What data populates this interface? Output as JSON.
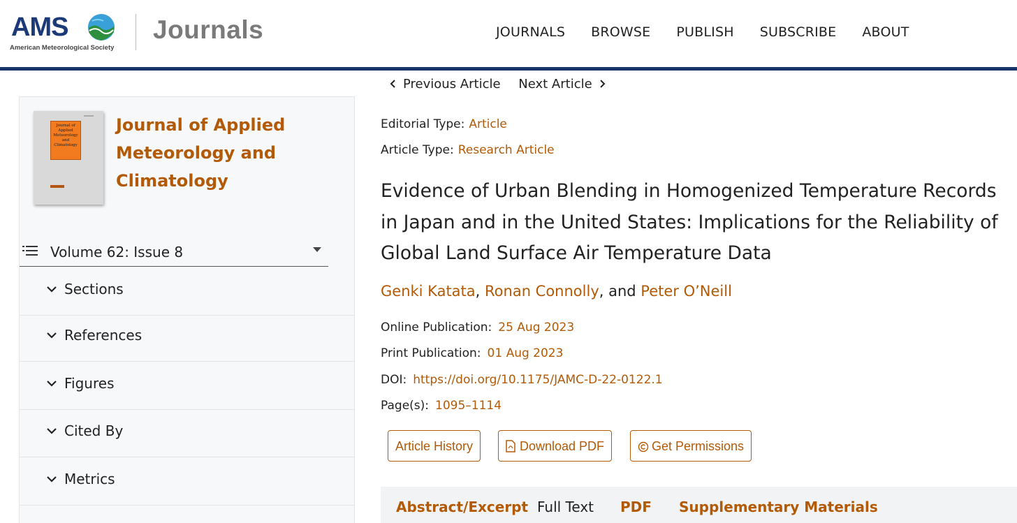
{
  "header": {
    "logo_text": "AMS",
    "logo_subtext": "American Meteorological Society",
    "site_name": "Journals",
    "nav": [
      "JOURNALS",
      "BROWSE",
      "PUBLISH",
      "SUBSCRIBE",
      "ABOUT"
    ]
  },
  "sidebar": {
    "journal_title": "Journal of Applied Meteorology and Climatology",
    "cover_text": "Journal of Applied Meteorology and Climatology",
    "volume": "Volume 62: Issue 8",
    "sections": [
      "Sections",
      "References",
      "Figures",
      "Cited By",
      "Metrics"
    ]
  },
  "pager": {
    "previous": "Previous Article",
    "next": "Next Article"
  },
  "meta": {
    "editorial_type_label": "Editorial Type:",
    "editorial_type": "Article",
    "article_type_label": "Article Type:",
    "article_type": "Research Article",
    "online_pub_label": "Online Publication:",
    "online_pub": "25 Aug 2023",
    "print_pub_label": "Print Publication:",
    "print_pub": "01 Aug 2023",
    "doi_label": "DOI:",
    "doi": "https://doi.org/10.1175/JAMC-D-22-0122.1",
    "pages_label": "Page(s):",
    "pages": "1095–1114"
  },
  "article": {
    "title": "Evidence of Urban Blending in Homogenized Temperature Records in Japan and in the United States: Implications for the Reliability of Global Land Surface Air Temperature Data",
    "authors": [
      "Genki Katata",
      "Ronan Connolly",
      "Peter O’Neill"
    ],
    "author_sep1": ", ",
    "author_sep2": ", and "
  },
  "buttons": {
    "history": "Article History",
    "download": "Download PDF",
    "permissions": "Get Permissions"
  },
  "tabs": [
    "Abstract/Excerpt",
    "Full Text",
    "PDF",
    "Supplementary Materials"
  ],
  "colors": {
    "accent": "#b35a07",
    "header_rule": "#17346b",
    "logo_blue": "#1d3a78"
  }
}
